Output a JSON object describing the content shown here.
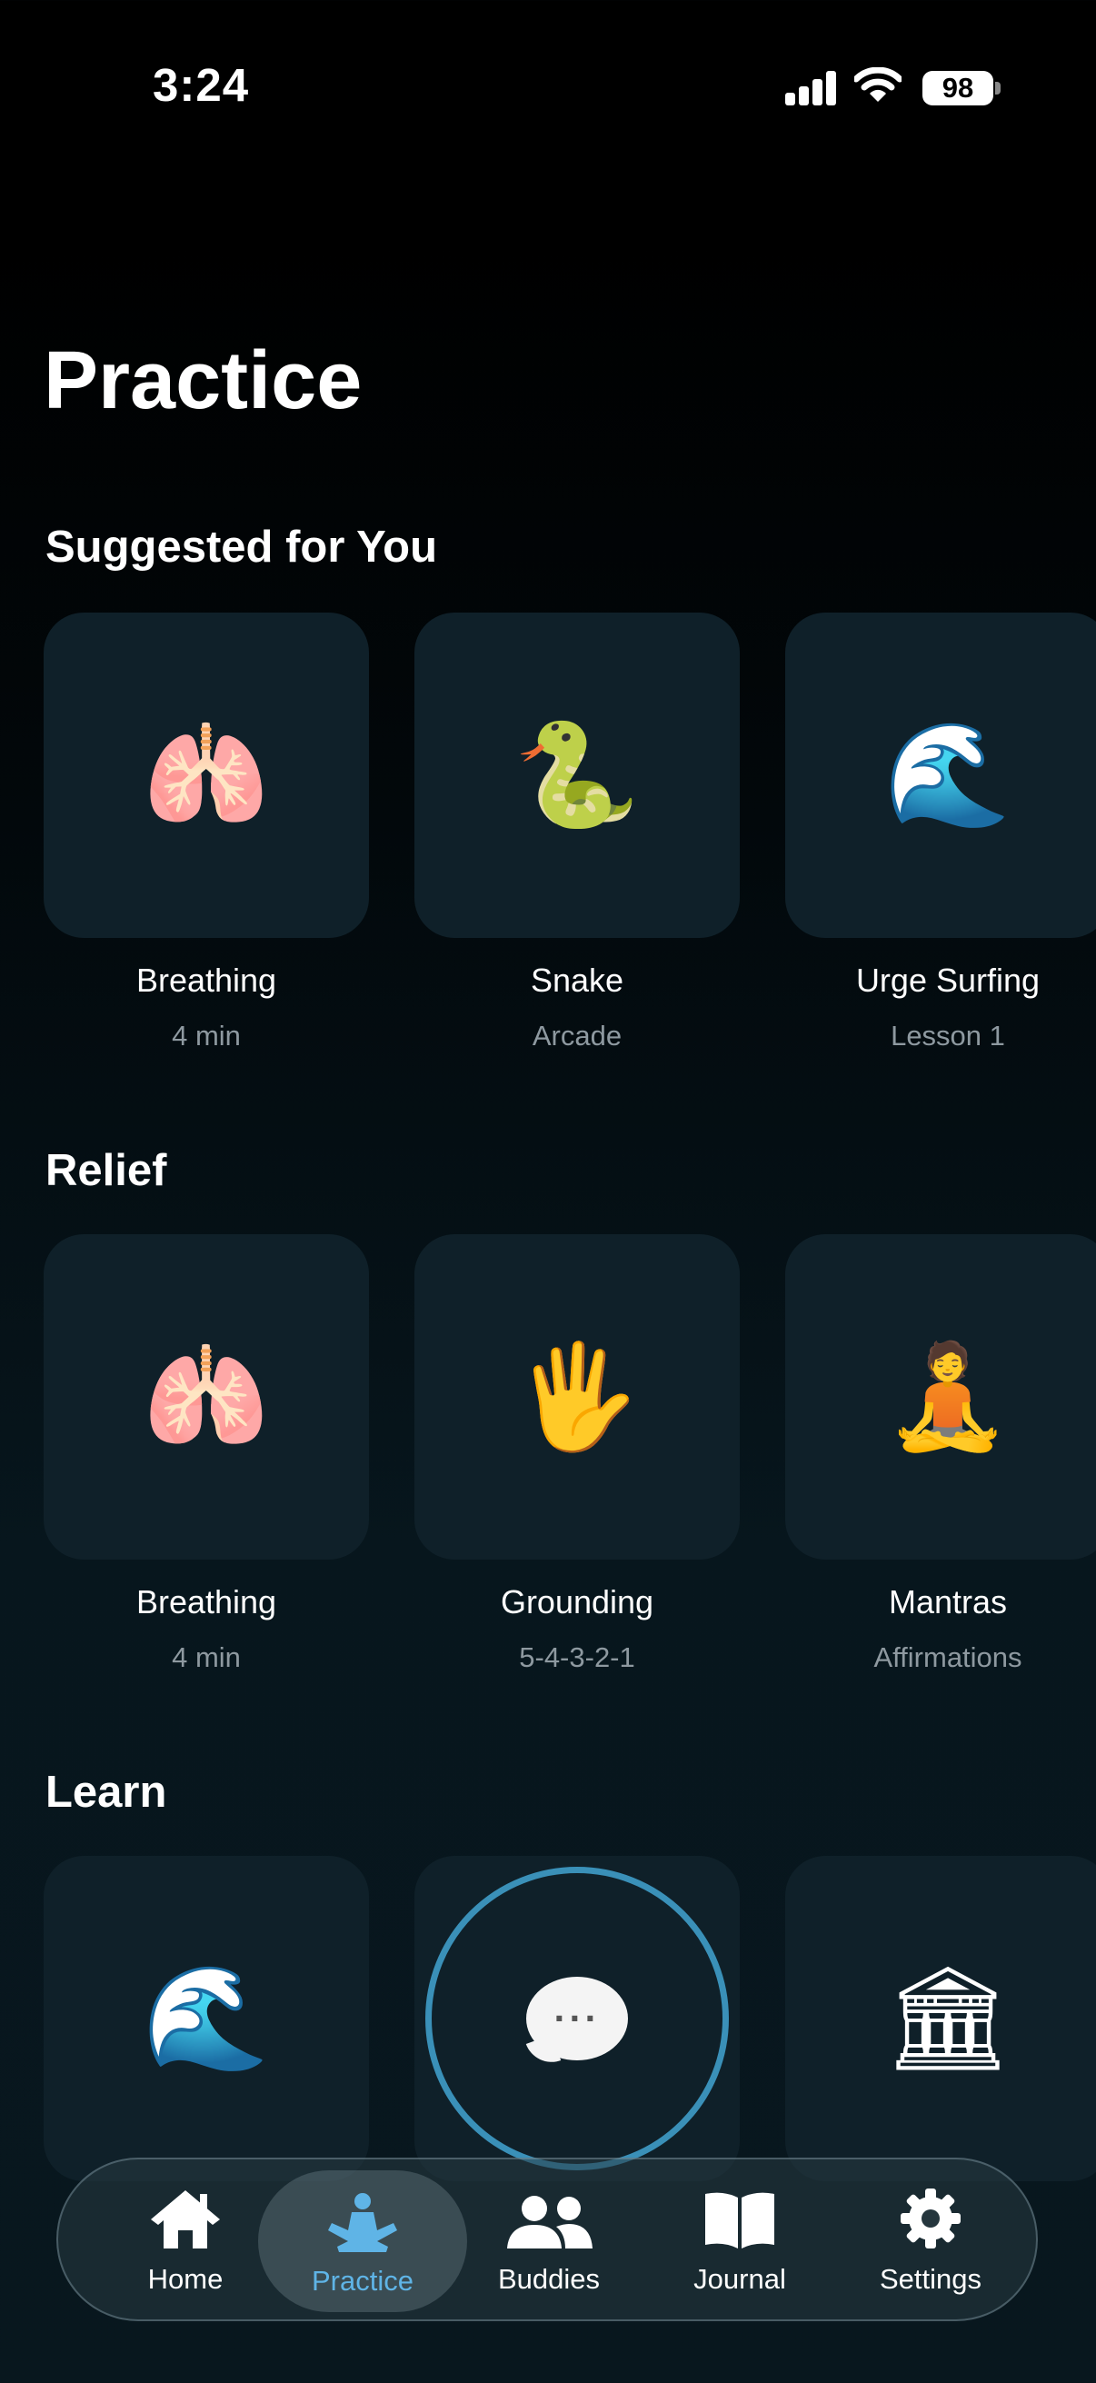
{
  "status_bar": {
    "time": "3:24",
    "battery": "98"
  },
  "page_title": "Practice",
  "sections": [
    {
      "title": "Suggested for You",
      "items": [
        {
          "emoji": "🫁",
          "icon": "lungs-icon",
          "label": "Breathing",
          "sub": "4 min"
        },
        {
          "emoji": "🐍",
          "icon": "snake-icon",
          "label": "Snake",
          "sub": "Arcade"
        },
        {
          "emoji": "🌊",
          "icon": "wave-icon",
          "label": "Urge Surfing",
          "sub": "Lesson 1"
        }
      ]
    },
    {
      "title": "Relief",
      "items": [
        {
          "emoji": "🫁",
          "icon": "lungs-icon",
          "label": "Breathing",
          "sub": "4 min"
        },
        {
          "emoji": "🖐",
          "icon": "hand-icon",
          "label": "Grounding",
          "sub": "5-4-3-2-1"
        },
        {
          "emoji": "🧘",
          "icon": "meditation-icon",
          "label": "Mantras",
          "sub": "Affirmations"
        }
      ]
    },
    {
      "title": "Learn",
      "items": [
        {
          "emoji": "🌊",
          "icon": "wave-icon"
        },
        {
          "emoji": "···",
          "icon": "speech-bubble-icon"
        },
        {
          "emoji": "🏛",
          "icon": "classical-building-icon"
        }
      ]
    }
  ],
  "tab_bar": {
    "tabs": [
      {
        "label": "Home",
        "icon": "house-icon"
      },
      {
        "label": "Practice",
        "icon": "meditation-icon",
        "active": true
      },
      {
        "label": "Buddies",
        "icon": "people-icon"
      },
      {
        "label": "Journal",
        "icon": "book-icon"
      },
      {
        "label": "Settings",
        "icon": "gear-icon"
      }
    ],
    "accent": "#5fb4e6"
  }
}
